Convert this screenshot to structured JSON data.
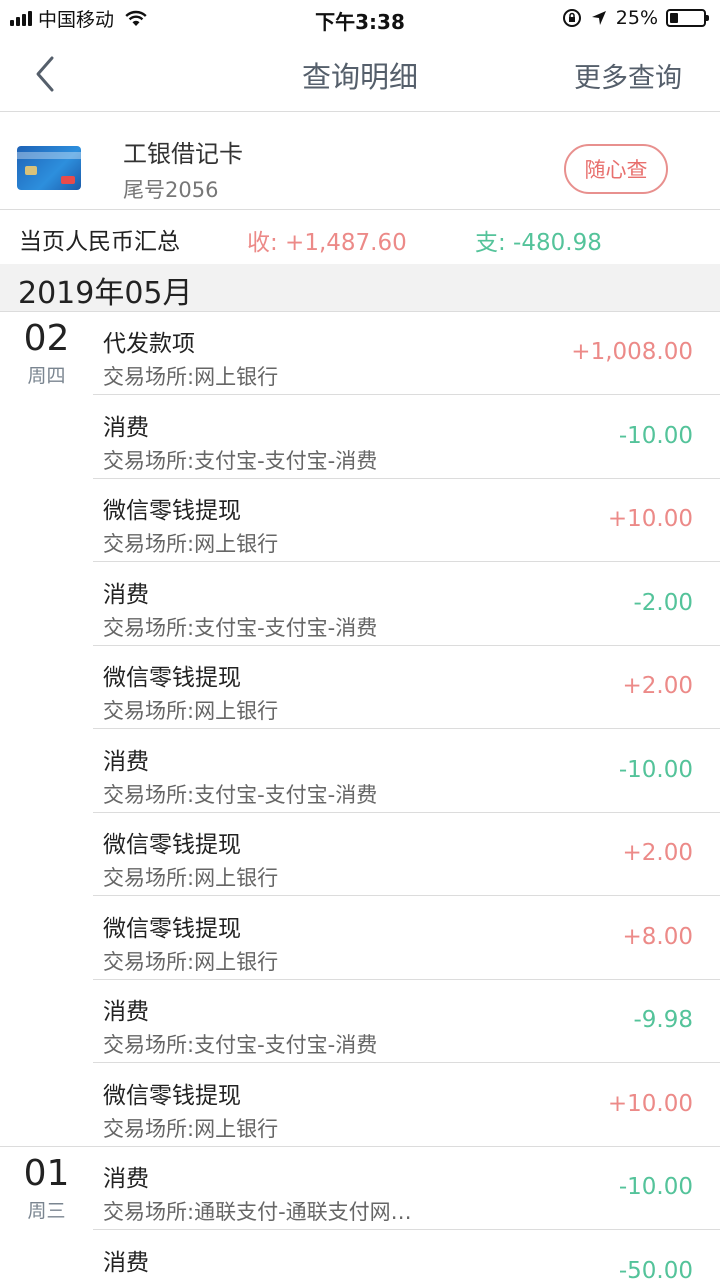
{
  "status_bar": {
    "carrier": "中国移动",
    "time": "下午3:38",
    "battery_percent": "25%",
    "battery_level": 0.25
  },
  "nav": {
    "title": "查询明细",
    "more_label": "更多查询",
    "back_icon": "chevron-left-icon"
  },
  "card": {
    "name": "工银借记卡",
    "tail": "尾号2056",
    "query_button": "随心查"
  },
  "summary": {
    "label": "当页人民币汇总",
    "income": "收: +1,487.60",
    "expense": "支: -480.98"
  },
  "month": "2019年05月",
  "days": [
    {
      "day": "02",
      "weekday": "周四",
      "transactions": [
        {
          "title": "代发款项",
          "place": "交易场所:网上银行",
          "amount": "+1,008.00",
          "type": "in"
        },
        {
          "title": "消费",
          "place": "交易场所:支付宝-支付宝-消费",
          "amount": "-10.00",
          "type": "out"
        },
        {
          "title": "微信零钱提现",
          "place": "交易场所:网上银行",
          "amount": "+10.00",
          "type": "in"
        },
        {
          "title": "消费",
          "place": "交易场所:支付宝-支付宝-消费",
          "amount": "-2.00",
          "type": "out"
        },
        {
          "title": "微信零钱提现",
          "place": "交易场所:网上银行",
          "amount": "+2.00",
          "type": "in"
        },
        {
          "title": "消费",
          "place": "交易场所:支付宝-支付宝-消费",
          "amount": "-10.00",
          "type": "out"
        },
        {
          "title": "微信零钱提现",
          "place": "交易场所:网上银行",
          "amount": "+2.00",
          "type": "in"
        },
        {
          "title": "微信零钱提现",
          "place": "交易场所:网上银行",
          "amount": "+8.00",
          "type": "in"
        },
        {
          "title": "消费",
          "place": "交易场所:支付宝-支付宝-消费",
          "amount": "-9.98",
          "type": "out"
        },
        {
          "title": "微信零钱提现",
          "place": "交易场所:网上银行",
          "amount": "+10.00",
          "type": "in"
        }
      ]
    },
    {
      "day": "01",
      "weekday": "周三",
      "transactions": [
        {
          "title": "消费",
          "place": "交易场所:通联支付-通联支付网…",
          "amount": "-10.00",
          "type": "out"
        },
        {
          "title": "消费",
          "place": "",
          "amount": "-50.00",
          "type": "out"
        }
      ]
    }
  ],
  "colors": {
    "income": "#ec8a88",
    "expense": "#54c39a",
    "nav_text": "#555f6b"
  }
}
